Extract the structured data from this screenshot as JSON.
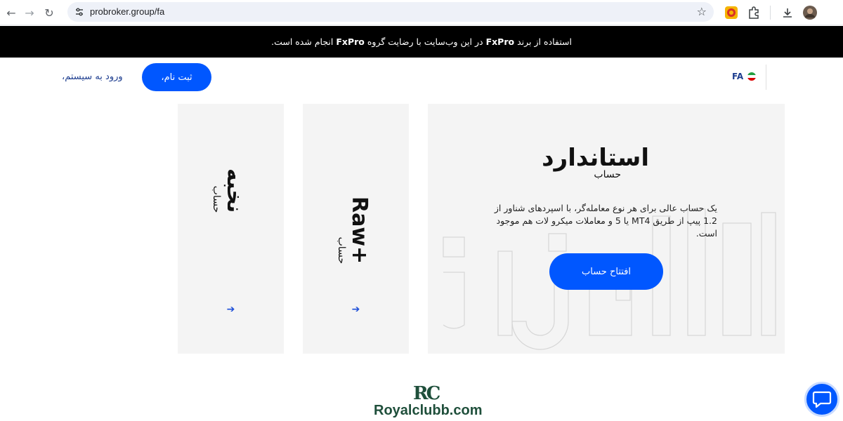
{
  "browser": {
    "url": "probroker.group/fa",
    "icons": [
      "back-icon",
      "forward-icon",
      "reload-icon",
      "site-info-icon",
      "bookmark-star-icon",
      "extension-icon",
      "puzzle-icon",
      "download-icon",
      "profile-avatar"
    ]
  },
  "banner": {
    "part1": "استفاده از برند",
    "brand1": "FxPro",
    "part2": "در این وب‌سایت با رضایت گروه",
    "brand2": "FxPro",
    "part3": "انجام شده است."
  },
  "header": {
    "login_label": "ورود به سیستم،",
    "signup_label": "ثبت نام،",
    "language": "FA"
  },
  "cards": [
    {
      "title": "نخبه",
      "subtitle": "حساب",
      "arrow": "➔"
    },
    {
      "title": "Raw+",
      "subtitle": "حساب",
      "arrow": "➔"
    }
  ],
  "standard_card": {
    "title": "استاندارد",
    "subtitle": "حساب",
    "description": "یک حساب عالی برای هر نوع معامله‌گر، با اسپردهای شناور از 1.2 پیپ از طریق MT4 یا 5 و معاملات میکرو لات هم موجود است.",
    "button_label": "افتتاح حساب"
  },
  "footer": {
    "logo_mark": "RC",
    "logo_text": "Royalclubb.com"
  },
  "colors": {
    "accent": "#0057ff",
    "banner_bg": "#000000",
    "card_bg": "#f4f4f4",
    "link": "#1d3d8f"
  }
}
